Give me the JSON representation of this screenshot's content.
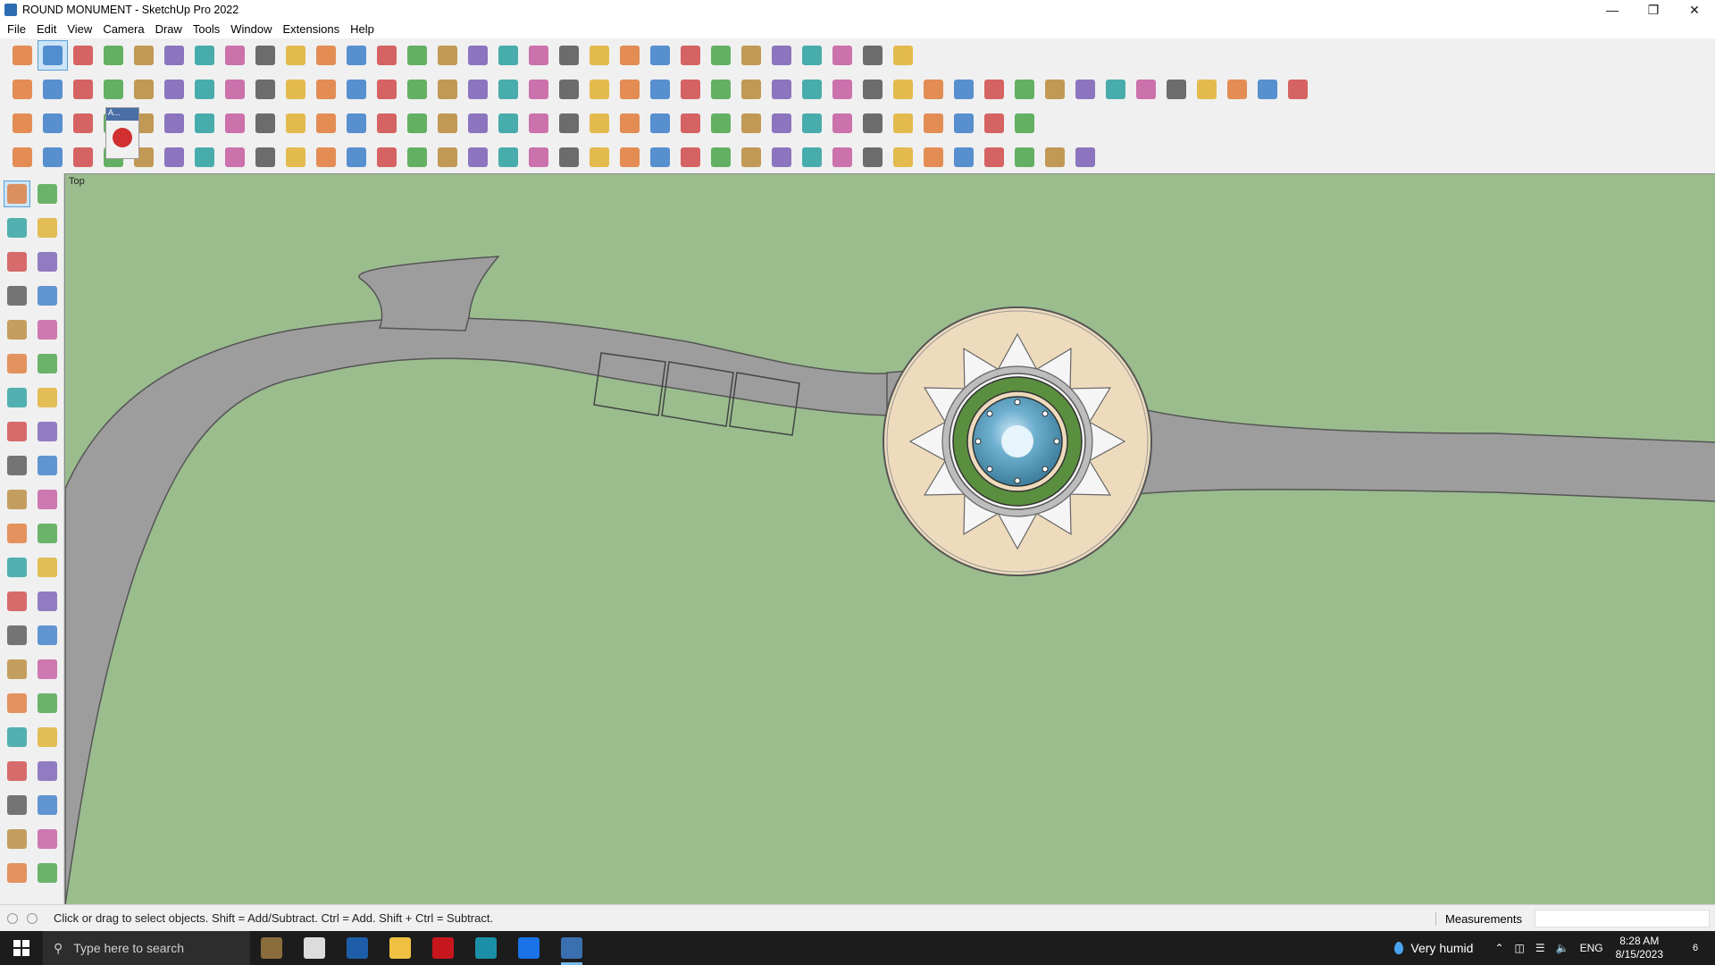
{
  "window": {
    "title": "ROUND MONUMENT - SketchUp Pro 2022",
    "minimize": "—",
    "restore": "❐",
    "close": "✕"
  },
  "menu": [
    "File",
    "Edit",
    "View",
    "Camera",
    "Draw",
    "Tools",
    "Window",
    "Extensions",
    "Help"
  ],
  "toolbars": {
    "row1_icons": [
      "zoom-icon",
      "select-icon",
      "eraser-icon",
      "pencil-icon",
      "lasso-icon",
      "rectangle-icon",
      "push-pull-icon",
      "follow-me-icon",
      "move-icon",
      "rotate-icon",
      "scale-icon",
      "tape-measure-icon",
      "text-icon",
      "paint-bucket-icon",
      "orbit-icon",
      "pan-icon",
      "zoom-window-icon",
      "zoom-extents-icon",
      "previous-view-icon",
      "next-view-icon",
      "standard-views-icon",
      "style-icon",
      "components-icon",
      "materials-icon",
      "layers-icon",
      "section-plane-icon",
      "dimension-icon",
      "undo-icon",
      "redo-icon",
      "walk-icon"
    ],
    "row2_icons": [
      "iso-view-icon",
      "top-view-icon",
      "front-view-icon",
      "right-view-icon",
      "back-view-icon",
      "left-view-icon",
      "box-icon",
      "cylinder-icon",
      "sphere-icon",
      "cone-icon",
      "torus-icon",
      "tube-icon",
      "dome-icon",
      "helix-icon",
      "polygon-icon",
      "sketch-icon",
      "wall-icon",
      "roof-icon",
      "house-icon",
      "window-tool-icon",
      "door-icon",
      "stairs-icon",
      "text-style-icon",
      "leaf-icon",
      "ruler-icon",
      "square-icon",
      "circle-icon",
      "hexagon-icon",
      "ellipse-icon",
      "parallelogram-icon",
      "arc-icon",
      "spiral-icon",
      "curve-icon",
      "freehand-icon",
      "measure-icon",
      "magic-icon",
      "render-icon",
      "grid-icon",
      "face-icon",
      "extrude-icon",
      "soften-icon",
      "fillet-icon",
      "chamfer-icon"
    ],
    "row3_icons": [
      "solid-union-icon",
      "solid-subtract-icon",
      "solid-intersect-icon",
      "solid-trim-icon",
      "solid-split-icon",
      "outer-shell-icon",
      "loop-icon",
      "red-square-icon",
      "box-split-icon",
      "panel-icon",
      "fold-icon",
      "bezier-icon",
      "line-curve-icon",
      "pipe-icon",
      "cross-icon",
      "add-icon",
      "tripod-icon",
      "flask-icon",
      "warning-icon",
      "loop-two-icon",
      "gear-icon",
      "star-icon",
      "magnet-icon",
      "bucket-icon",
      "network-icon",
      "shapes-icon",
      "cube-icon",
      "components-set-icon",
      "frame-icon",
      "grid-orange-icon",
      "grid-yellow-icon",
      "explode-icon",
      "curve-nodes-icon",
      "matrix-icon"
    ],
    "row4_icons": [
      "draw-curve-icon",
      "bspline-icon",
      "truck-icon",
      "drag-icon",
      "slice-icon",
      "wrap-icon",
      "sweep-icon",
      "loft-icon",
      "bridge-icon",
      "corner-icon",
      "edge-icon",
      "arc-edge-icon",
      "offset-icon",
      "shape-icon",
      "fence-icon",
      "columns-icon",
      "stairs-tool-icon",
      "hand-icon",
      "panel-edit-icon",
      "fan-icon",
      "stack-icon",
      "slab-icon",
      "slope-icon",
      "rafter-icon",
      "truss-icon",
      "beam-icon",
      "wall-frame-icon",
      "brace-icon",
      "hatch-icon",
      "lattice-icon",
      "bars-icon",
      "spokes-icon",
      "rotary-icon",
      "shades-icon",
      "dome-frame-icon",
      "roof-frame-icon"
    ],
    "floating_label": "A..."
  },
  "left_toolbar_icons": [
    "select-icon",
    "orbit-icon",
    "paint-bucket-icon",
    "eraser-icon",
    "components-icon",
    "pencil-icon",
    "line-icon",
    "freehand-icon",
    "rectangle-icon",
    "rotated-rect-icon",
    "circle-icon",
    "polygon-icon",
    "arc-icon",
    "pie-icon",
    "two-point-arc-icon",
    "three-point-arc-icon",
    "move-icon",
    "push-pull-icon",
    "rotate-icon",
    "follow-me-icon",
    "scale-icon",
    "offset-icon",
    "tape-measure-icon",
    "dimension-icon",
    "protractor-icon",
    "text-icon",
    "axes-icon",
    "3d-text-icon",
    "orbit-view-icon",
    "pan-icon",
    "zoom-icon",
    "zoom-window-icon",
    "zoom-extents-icon",
    "position-camera-icon",
    "look-around-icon",
    "walk-icon",
    "section-plane-icon",
    "section-display-icon",
    "style-icon",
    "layers-icon",
    "outliner-icon",
    "xray-icon"
  ],
  "viewport": {
    "scene_label": "Top",
    "colors": {
      "ground": "#9bbd8e",
      "road": "#9c9c9c",
      "plaza": "#eedbbd",
      "lawn": "#5a8f3f",
      "water": "#4a90b0",
      "petal": "#f5f5f5"
    }
  },
  "status": {
    "hint": "Click or drag to select objects. Shift = Add/Subtract. Ctrl = Add. Shift + Ctrl = Subtract.",
    "measurements_label": "Measurements",
    "measurements_value": ""
  },
  "taskbar": {
    "search_placeholder": "Type here to search",
    "apps": [
      "widgets-icon",
      "task-view-icon",
      "calculator-icon",
      "file-explorer-icon",
      "acrobat-icon",
      "3ds-max-icon",
      "edge-icon",
      "sketchup-icon"
    ],
    "weather": "Very humid",
    "language": "ENG",
    "time": "8:28 AM",
    "date": "8/15/2023",
    "notification_count": "6"
  }
}
